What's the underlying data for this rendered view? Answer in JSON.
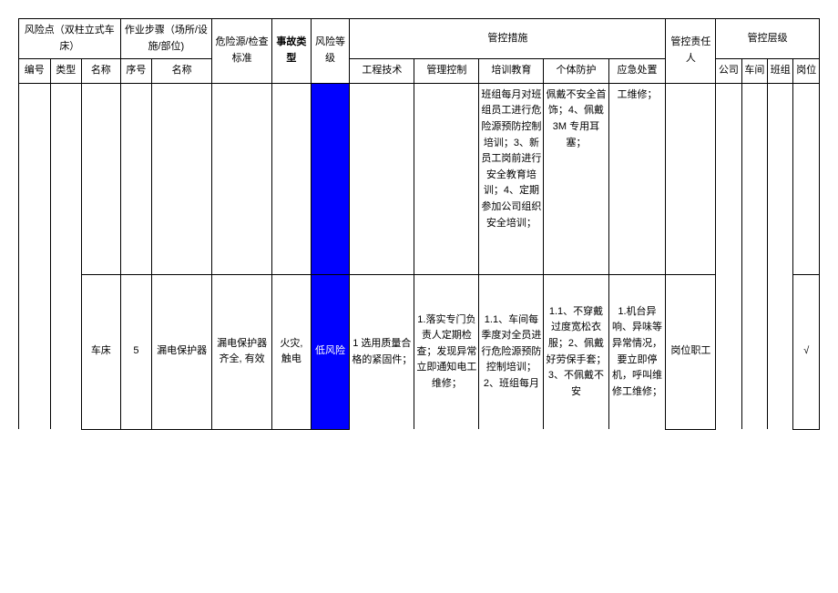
{
  "headers": {
    "risk_point_group": "风险点（双柱立式车床）",
    "work_step_group": "作业步骤（场所/设施/部位)",
    "hazard_std": "危险源/检查标准",
    "accident_type": "事故类型",
    "risk_level": "风险等级",
    "control_measures": "管控措施",
    "responsible": "管控责任人",
    "control_level_group": "管控层级",
    "id": "编号",
    "type": "类型",
    "name": "名称",
    "seq": "序号",
    "name2": "名称",
    "eng_tech": "工程技术",
    "mgmt_ctrl": "管理控制",
    "training": "培训教育",
    "ppe": "个体防护",
    "emergency": "应急处置",
    "company": "公司",
    "workshop": "车间",
    "team": "班组",
    "position": "岗位"
  },
  "row1": {
    "training": "班组每月对班组员工进行危险源预防控制培训；3、新员工岗前进行安全教育培训；4、定期参加公司组织安全培训；",
    "ppe": "佩戴不安全首饰；4、佩戴 3M 专用耳塞；",
    "emergency": "工维修；"
  },
  "row2": {
    "name": "车床",
    "seq": "5",
    "step_name": "漏电保护器",
    "hazard": "漏电保护器齐全, 有效",
    "accident": "火灾, 触电",
    "risk": "低风险",
    "eng_tech": "1 选用质量合格的紧固件；",
    "mgmt_ctrl": "1.落实专门负责人定期检查；发现异常立即通知电工维修；",
    "training": "1.1、车间每季度对全员进行危险源预防控制培训；2、班组每月",
    "ppe": "1.1、不穿戴过度宽松衣服；2、佩戴好劳保手套；3、不佩戴不安",
    "emergency": "1.机台异响、异味等异常情况，要立即停机，呼叫维修工维修；",
    "responsible": "岗位职工",
    "position_check": "√"
  }
}
